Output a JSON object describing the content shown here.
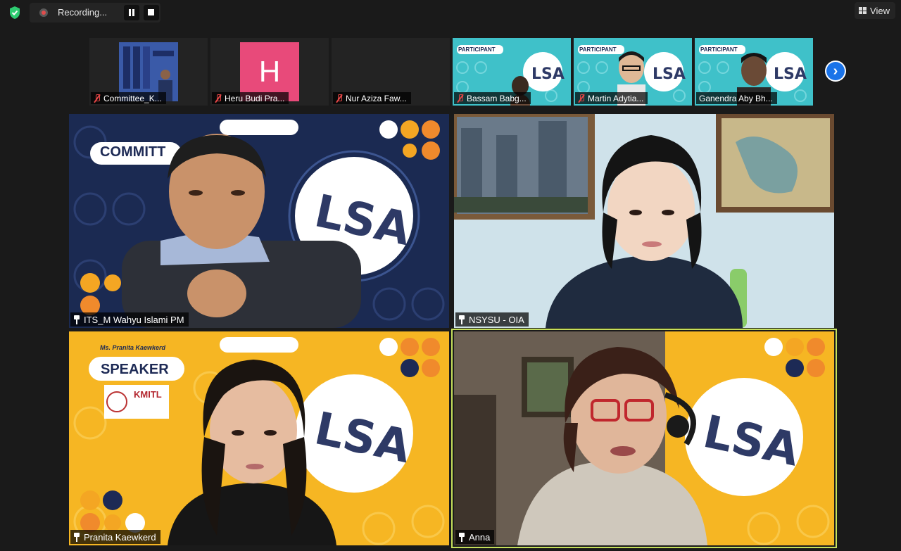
{
  "toolbar": {
    "recording_label": "Recording...",
    "view_label": "View"
  },
  "thumbnails": [
    {
      "name": "Committee_K...",
      "muted": true,
      "kind": "photo"
    },
    {
      "name": "Heru Budi Pra...",
      "muted": true,
      "kind": "avatar",
      "avatar_letter": "H",
      "avatar_color": "#e84a7a"
    },
    {
      "name": "Nur Aziza Faw...",
      "muted": true,
      "kind": "blank"
    },
    {
      "name": "Bassam Babg...",
      "muted": true,
      "kind": "participant",
      "banner": "PARTICIPANT"
    },
    {
      "name": "Martin Adytia...",
      "muted": true,
      "kind": "participant",
      "banner": "PARTICIPANT"
    },
    {
      "name": "Ganendra Aby Bh...",
      "muted": false,
      "kind": "participant",
      "banner": "PARTICIPANT"
    }
  ],
  "tiles": [
    {
      "name": "ITS_M Wahyu Islami PM",
      "banner": "COMMITT",
      "bg": "#1b2a52"
    },
    {
      "name": "NSYSU - OIA",
      "bg": "#cfe2ea"
    },
    {
      "name": "Pranita Kaewkerd",
      "banner": "SPEAKER",
      "subtitle": "Ms. Pranita Kaewkerd",
      "org": "KMITL",
      "bg": "#f6b623"
    },
    {
      "name": "Anna",
      "bg": "#f6b623",
      "active_speaker": true
    }
  ],
  "colors": {
    "background": "#1a1a1a",
    "accent_blue": "#1a73e8",
    "active_speaker": "#c6e05b",
    "mute_red": "#e04545",
    "shield_green": "#2ecc71",
    "teal": "#3fc1c9"
  }
}
